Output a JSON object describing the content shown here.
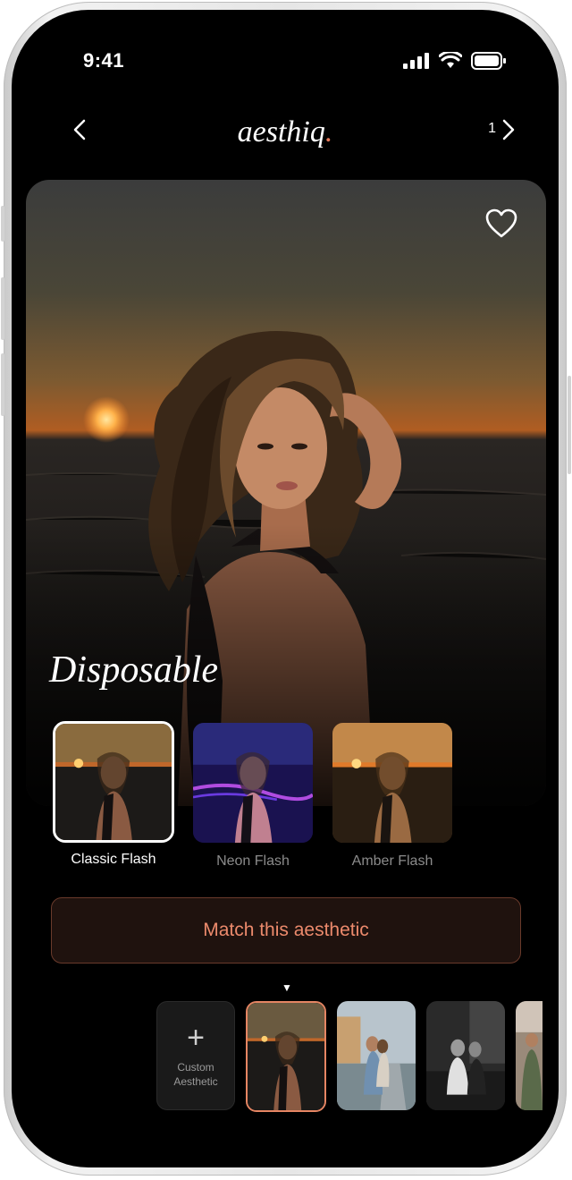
{
  "status_bar": {
    "time": "9:41"
  },
  "header": {
    "logo_text": "aesthiq",
    "logo_dot": ".",
    "count": "1"
  },
  "hero": {
    "style_name": "Disposable"
  },
  "filters": [
    {
      "label": "Classic Flash",
      "active": true
    },
    {
      "label": "Neon Flash",
      "active": false
    },
    {
      "label": "Amber Flash",
      "active": false
    }
  ],
  "cta": {
    "label": "Match this aesthetic"
  },
  "strip": {
    "indicator": "▼",
    "custom_plus": "+",
    "custom_label_line1": "Custom",
    "custom_label_line2": "Aesthetic"
  },
  "colors": {
    "accent": "#e77a5a",
    "cta_text": "#ec8a6c",
    "cta_bg": "#1f120e",
    "screen_bg": "#000000"
  },
  "icons": [
    "chevron-left-icon",
    "chevron-right-icon",
    "heart-icon",
    "signal-icon",
    "wifi-icon",
    "battery-icon",
    "plus-icon"
  ]
}
